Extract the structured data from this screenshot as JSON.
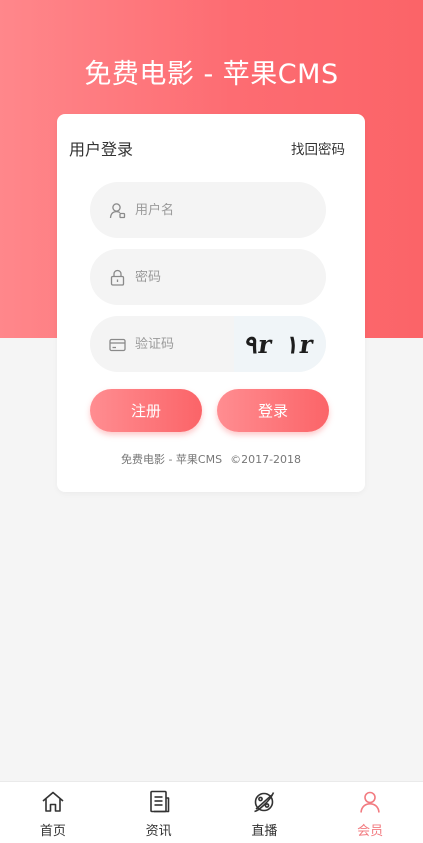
{
  "site": {
    "title": "免费电影 - 苹果CMS"
  },
  "login": {
    "title": "用户登录",
    "forgot_label": "找回密码",
    "username": {
      "placeholder": "用户名",
      "value": "",
      "icon": "user-icon"
    },
    "password": {
      "placeholder": "密码",
      "value": "",
      "icon": "lock-icon"
    },
    "captcha": {
      "placeholder": "验证码",
      "value": "",
      "icon": "card-icon",
      "image_text": "۹r ۱r"
    },
    "register_label": "注册",
    "login_label": "登录"
  },
  "footer": {
    "site_name": "免费电影 - 苹果CMS",
    "copyright": "©2017-2018"
  },
  "tabbar": {
    "items": [
      {
        "label": "首页",
        "icon": "home-icon",
        "active": false
      },
      {
        "label": "资讯",
        "icon": "news-icon",
        "active": false
      },
      {
        "label": "直播",
        "icon": "planet-icon",
        "active": false
      },
      {
        "label": "会员",
        "icon": "member-icon",
        "active": true
      }
    ]
  },
  "colors": {
    "accent": "#fb6468",
    "accent_light": "#ff878b",
    "active_tab": "#f27b80",
    "background": "#f5f5f5"
  }
}
